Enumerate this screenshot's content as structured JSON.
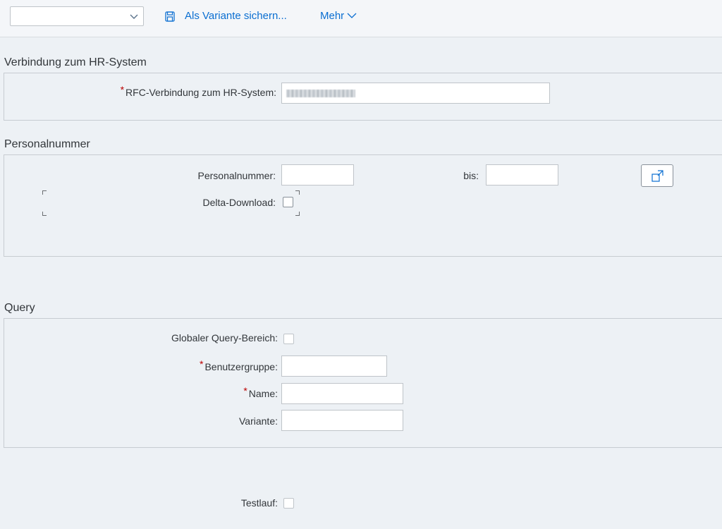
{
  "toolbar": {
    "variant_select_value": "",
    "save_variant_label": "Als Variante sichern...",
    "more_label": "Mehr"
  },
  "section_hr": {
    "title": "Verbindung zum HR-System",
    "rfc_label": "RFC-Verbindung zum HR-System:",
    "rfc_required": "*"
  },
  "section_personal": {
    "title": "Personalnummer",
    "personalnummer_label": "Personalnummer:",
    "personalnummer_value": "",
    "bis_label": "bis:",
    "bis_value": "",
    "delta_label": "Delta-Download:"
  },
  "section_query": {
    "title": "Query",
    "global_label": "Globaler Query-Bereich:",
    "benutzergruppe_label": "Benutzergruppe:",
    "benutzergruppe_value": "",
    "name_label": "Name:",
    "name_value": "",
    "variante_label": "Variante:",
    "variante_value": "",
    "required_mark": "*"
  },
  "testlauf_label": "Testlauf:",
  "icons": {
    "variant_dropdown": "chevron-down-icon",
    "save": "save-icon",
    "more": "chevron-down-icon",
    "multiple_selection": "multiple-selection-icon"
  },
  "colors": {
    "accent": "#0a6ed1",
    "required": "#bb0000",
    "background": "#edf1f5"
  }
}
